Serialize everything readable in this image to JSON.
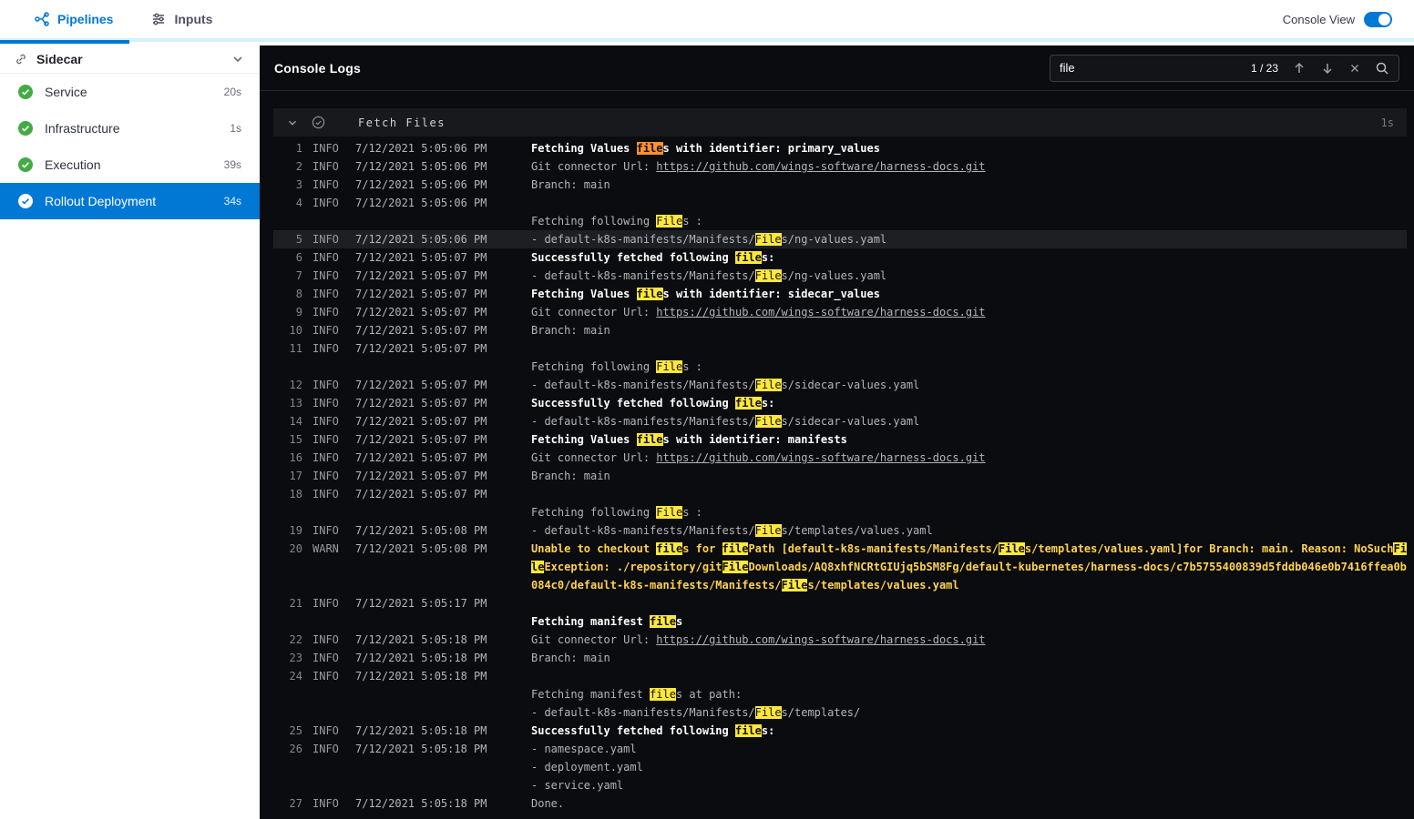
{
  "colors": {
    "accent": "#0278d5",
    "success_green": "#42ab45",
    "search_highlight": "#ffe83b",
    "search_current": "#ff9030",
    "warn_text": "#ffd24d",
    "console_bg": "#0b0c0f"
  },
  "icons": {
    "pipelines-icon": "branching pipeline nodes",
    "inputs-icon": "sliders",
    "link-icon": "chain link",
    "chevron-down-icon": "v chevron",
    "check-circle-icon": "circled check",
    "prev-match-icon": "arrow up",
    "next-match-icon": "arrow down",
    "clear-search-icon": "x",
    "search-icon": "magnifier",
    "status-success-icon": "green circle check"
  },
  "topbar": {
    "tabs": [
      {
        "label": "Pipelines"
      },
      {
        "label": "Inputs"
      }
    ],
    "console_view_label": "Console View"
  },
  "sidebar": {
    "title": "Sidecar",
    "items": [
      {
        "label": "Service",
        "duration": "20s",
        "status": "success"
      },
      {
        "label": "Infrastructure",
        "duration": "1s",
        "status": "success"
      },
      {
        "label": "Execution",
        "duration": "39s",
        "status": "success"
      },
      {
        "label": "Rollout Deployment",
        "duration": "34s",
        "status": "success",
        "selected": true
      }
    ]
  },
  "console": {
    "title": "Console Logs",
    "search": {
      "value": "file",
      "counter": "1 / 23"
    },
    "section": {
      "title": "Fetch Files",
      "duration": "1s"
    },
    "logs": [
      {
        "num": "1",
        "level": "INFO",
        "time": "7/12/2021 5:05:06 PM",
        "spans": [
          {
            "t": "Fetching Values ",
            "c": "b"
          },
          {
            "t": "file",
            "c": "b cur"
          },
          {
            "t": "s with identifier: primary_values",
            "c": "b"
          }
        ]
      },
      {
        "num": "2",
        "level": "INFO",
        "time": "7/12/2021 5:05:06 PM",
        "spans": [
          {
            "t": "Git connector Url: "
          },
          {
            "t": "https://github.com/wings-software/harness-docs.git",
            "c": "lnk"
          }
        ]
      },
      {
        "num": "3",
        "level": "INFO",
        "time": "7/12/2021 5:05:06 PM",
        "spans": [
          {
            "t": "Branch: main"
          }
        ]
      },
      {
        "num": "4",
        "level": "INFO",
        "time": "7/12/2021 5:05:06 PM",
        "spans": [
          {
            "t": "\nFetching following "
          },
          {
            "t": "File",
            "c": "hl"
          },
          {
            "t": "s :"
          }
        ]
      },
      {
        "num": "5",
        "level": "INFO",
        "time": "7/12/2021 5:05:06 PM",
        "selected": true,
        "spans": [
          {
            "t": "- default-k8s-manifests/Manifests/"
          },
          {
            "t": "File",
            "c": "hl"
          },
          {
            "t": "s/ng-values.yaml"
          }
        ]
      },
      {
        "num": "6",
        "level": "INFO",
        "time": "7/12/2021 5:05:07 PM",
        "spans": [
          {
            "t": "Successfully fetched following ",
            "c": "b"
          },
          {
            "t": "file",
            "c": "b hl"
          },
          {
            "t": "s:",
            "c": "b"
          }
        ]
      },
      {
        "num": "7",
        "level": "INFO",
        "time": "7/12/2021 5:05:07 PM",
        "spans": [
          {
            "t": "- default-k8s-manifests/Manifests/"
          },
          {
            "t": "File",
            "c": "hl"
          },
          {
            "t": "s/ng-values.yaml"
          }
        ]
      },
      {
        "num": "8",
        "level": "INFO",
        "time": "7/12/2021 5:05:07 PM",
        "spans": [
          {
            "t": "Fetching Values ",
            "c": "b"
          },
          {
            "t": "file",
            "c": "b hl"
          },
          {
            "t": "s with identifier: sidecar_values",
            "c": "b"
          }
        ]
      },
      {
        "num": "9",
        "level": "INFO",
        "time": "7/12/2021 5:05:07 PM",
        "spans": [
          {
            "t": "Git connector Url: "
          },
          {
            "t": "https://github.com/wings-software/harness-docs.git",
            "c": "lnk"
          }
        ]
      },
      {
        "num": "10",
        "level": "INFO",
        "time": "7/12/2021 5:05:07 PM",
        "spans": [
          {
            "t": "Branch: main"
          }
        ]
      },
      {
        "num": "11",
        "level": "INFO",
        "time": "7/12/2021 5:05:07 PM",
        "spans": [
          {
            "t": "\nFetching following "
          },
          {
            "t": "File",
            "c": "hl"
          },
          {
            "t": "s :"
          }
        ]
      },
      {
        "num": "12",
        "level": "INFO",
        "time": "7/12/2021 5:05:07 PM",
        "spans": [
          {
            "t": "- default-k8s-manifests/Manifests/"
          },
          {
            "t": "File",
            "c": "hl"
          },
          {
            "t": "s/sidecar-values.yaml"
          }
        ]
      },
      {
        "num": "13",
        "level": "INFO",
        "time": "7/12/2021 5:05:07 PM",
        "spans": [
          {
            "t": "Successfully fetched following ",
            "c": "b"
          },
          {
            "t": "file",
            "c": "b hl"
          },
          {
            "t": "s:",
            "c": "b"
          }
        ]
      },
      {
        "num": "14",
        "level": "INFO",
        "time": "7/12/2021 5:05:07 PM",
        "spans": [
          {
            "t": "- default-k8s-manifests/Manifests/"
          },
          {
            "t": "File",
            "c": "hl"
          },
          {
            "t": "s/sidecar-values.yaml"
          }
        ]
      },
      {
        "num": "15",
        "level": "INFO",
        "time": "7/12/2021 5:05:07 PM",
        "spans": [
          {
            "t": "Fetching Values ",
            "c": "b"
          },
          {
            "t": "file",
            "c": "b hl"
          },
          {
            "t": "s with identifier: manifests",
            "c": "b"
          }
        ]
      },
      {
        "num": "16",
        "level": "INFO",
        "time": "7/12/2021 5:05:07 PM",
        "spans": [
          {
            "t": "Git connector Url: "
          },
          {
            "t": "https://github.com/wings-software/harness-docs.git",
            "c": "lnk"
          }
        ]
      },
      {
        "num": "17",
        "level": "INFO",
        "time": "7/12/2021 5:05:07 PM",
        "spans": [
          {
            "t": "Branch: main"
          }
        ]
      },
      {
        "num": "18",
        "level": "INFO",
        "time": "7/12/2021 5:05:07 PM",
        "spans": [
          {
            "t": "\nFetching following "
          },
          {
            "t": "File",
            "c": "hl"
          },
          {
            "t": "s :"
          }
        ]
      },
      {
        "num": "19",
        "level": "INFO",
        "time": "7/12/2021 5:05:08 PM",
        "spans": [
          {
            "t": "- default-k8s-manifests/Manifests/"
          },
          {
            "t": "File",
            "c": "hl"
          },
          {
            "t": "s/templates/values.yaml"
          }
        ]
      },
      {
        "num": "20",
        "level": "WARN",
        "time": "7/12/2021 5:05:08 PM",
        "spans": [
          {
            "t": "Unable to checkout ",
            "c": "wb"
          },
          {
            "t": "file",
            "c": "wb hl"
          },
          {
            "t": "s for ",
            "c": "wb"
          },
          {
            "t": "file",
            "c": "wb hl"
          },
          {
            "t": "Path [default-k8s-manifests/Manifests/",
            "c": "wb"
          },
          {
            "t": "File",
            "c": "wb hl"
          },
          {
            "t": "s/templates/values.yaml]for Branch: main. Reason: NoSuch",
            "c": "wb"
          },
          {
            "t": "File",
            "c": "wb hl"
          },
          {
            "t": "Exception: ./repository/git",
            "c": "wb"
          },
          {
            "t": "File",
            "c": "wb hl"
          },
          {
            "t": "Downloads/AQ8xhfNCRtGIUjq5bSM8Fg/default-kubernetes/harness-docs/c7b5755400839d5fddb046e0b7416ffea0b084c0/default-k8s-manifests/Manifests/",
            "c": "wb"
          },
          {
            "t": "File",
            "c": "wb hl"
          },
          {
            "t": "s/templates/values.yaml",
            "c": "wb"
          }
        ]
      },
      {
        "num": "21",
        "level": "INFO",
        "time": "7/12/2021 5:05:17 PM",
        "spans": [
          {
            "t": "\n"
          },
          {
            "t": "Fetching manifest ",
            "c": "b"
          },
          {
            "t": "file",
            "c": "b hl"
          },
          {
            "t": "s",
            "c": "b"
          }
        ]
      },
      {
        "num": "22",
        "level": "INFO",
        "time": "7/12/2021 5:05:18 PM",
        "spans": [
          {
            "t": "Git connector Url: "
          },
          {
            "t": "https://github.com/wings-software/harness-docs.git",
            "c": "lnk"
          }
        ]
      },
      {
        "num": "23",
        "level": "INFO",
        "time": "7/12/2021 5:05:18 PM",
        "spans": [
          {
            "t": "Branch: main"
          }
        ]
      },
      {
        "num": "24",
        "level": "INFO",
        "time": "7/12/2021 5:05:18 PM",
        "spans": [
          {
            "t": "\nFetching manifest "
          },
          {
            "t": "file",
            "c": "hl"
          },
          {
            "t": "s at path:\n- default-k8s-manifests/Manifests/"
          },
          {
            "t": "File",
            "c": "hl"
          },
          {
            "t": "s/templates/"
          }
        ]
      },
      {
        "num": "25",
        "level": "INFO",
        "time": "7/12/2021 5:05:18 PM",
        "spans": [
          {
            "t": "Successfully fetched following ",
            "c": "b"
          },
          {
            "t": "file",
            "c": "b hl"
          },
          {
            "t": "s:",
            "c": "b"
          }
        ]
      },
      {
        "num": "26",
        "level": "INFO",
        "time": "7/12/2021 5:05:18 PM",
        "spans": [
          {
            "t": "- namespace.yaml\n- deployment.yaml\n- service.yaml"
          }
        ]
      },
      {
        "num": "27",
        "level": "INFO",
        "time": "7/12/2021 5:05:18 PM",
        "spans": [
          {
            "t": "Done."
          }
        ]
      }
    ]
  }
}
